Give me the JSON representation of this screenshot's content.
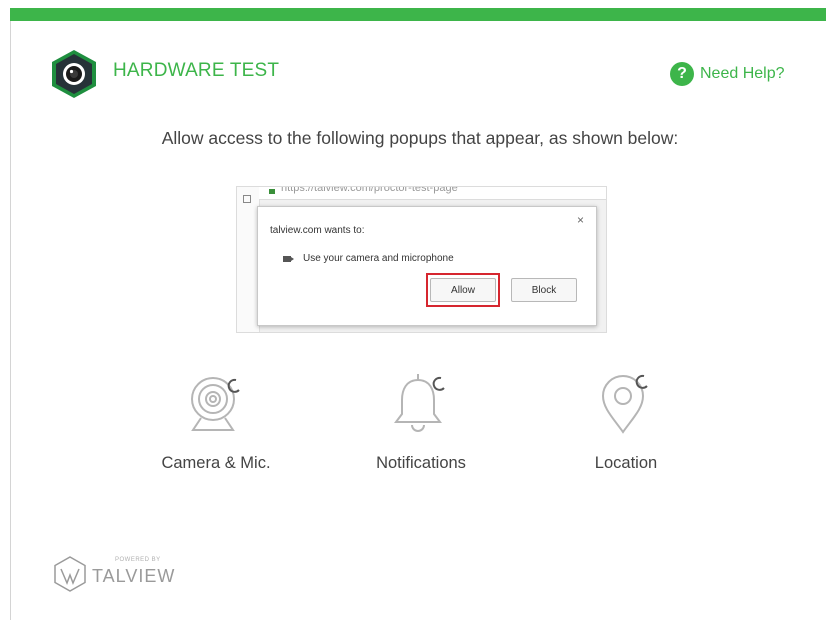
{
  "header": {
    "title": "HARDWARE TEST",
    "help_label": "Need Help?",
    "help_icon": "?"
  },
  "instruction": "Allow access to the following popups that appear, as shown below:",
  "example_popup": {
    "url_text": "https://talview.com/proctor-test-page",
    "close_glyph": "×",
    "wants_text": "talview.com wants to:",
    "permission_text": "Use your camera and microphone",
    "allow_label": "Allow",
    "block_label": "Block"
  },
  "permissions": [
    {
      "label": "Camera & Mic.",
      "icon": "webcam-icon"
    },
    {
      "label": "Notifications",
      "icon": "bell-icon"
    },
    {
      "label": "Location",
      "icon": "location-pin-icon"
    }
  ],
  "footer": {
    "powered_by": "POWERED BY",
    "brand": "TALVIEW"
  },
  "colors": {
    "accent": "#3db54a",
    "highlight": "#d6262f",
    "text": "#444444",
    "icon_gray": "#b5b5b5"
  }
}
